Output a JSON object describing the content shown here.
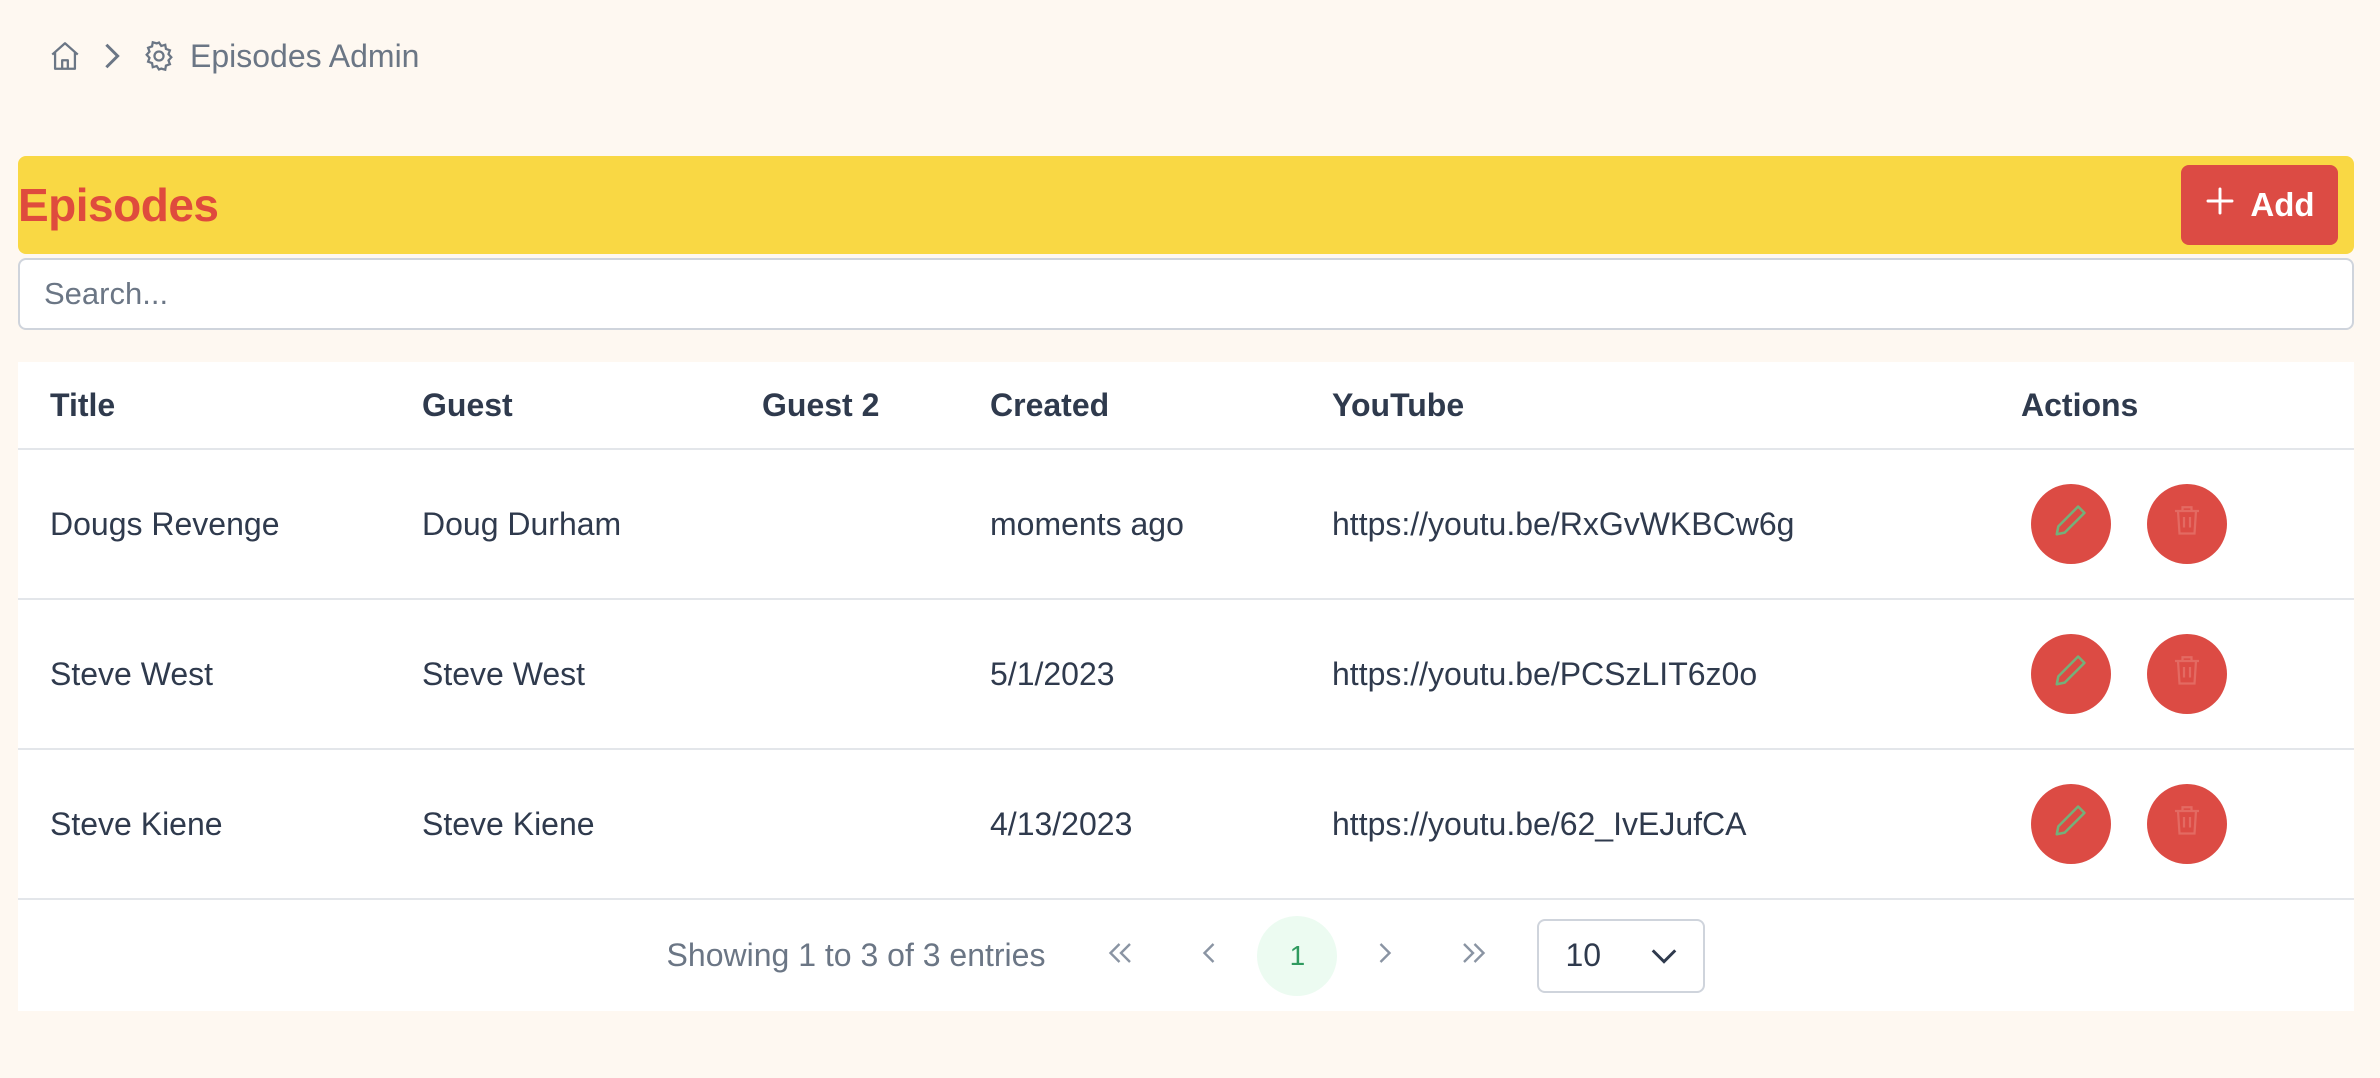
{
  "breadcrumb": {
    "home_icon": "home-icon",
    "separator_icon": "chevron-right-icon",
    "current_icon": "gear-icon",
    "current_label": "Episodes Admin"
  },
  "header": {
    "title": "Episodes",
    "add_label": "Add",
    "accent": "#dc4b44",
    "bar_color": "#f9d844"
  },
  "search": {
    "placeholder": "Search...",
    "value": ""
  },
  "table": {
    "columns": [
      "Title",
      "Guest",
      "Guest 2",
      "Created",
      "YouTube",
      "Actions"
    ],
    "rows": [
      {
        "title": "Dougs Revenge",
        "guest": "Doug Durham",
        "guest2": "",
        "created": "moments ago",
        "youtube": "https://youtu.be/RxGvWKBCw6g"
      },
      {
        "title": "Steve West",
        "guest": "Steve West",
        "guest2": "",
        "created": "5/1/2023",
        "youtube": "https://youtu.be/PCSzLIT6z0o"
      },
      {
        "title": "Steve Kiene",
        "guest": "Steve Kiene",
        "guest2": "",
        "created": "4/13/2023",
        "youtube": "https://youtu.be/62_IvEJufCA"
      }
    ]
  },
  "pagination": {
    "summary": "Showing 1 to 3 of 3 entries",
    "first_icon": "double-chevron-left-icon",
    "prev_icon": "chevron-left-icon",
    "current_page": "1",
    "next_icon": "chevron-right-icon",
    "last_icon": "double-chevron-right-icon",
    "page_size": "10"
  }
}
